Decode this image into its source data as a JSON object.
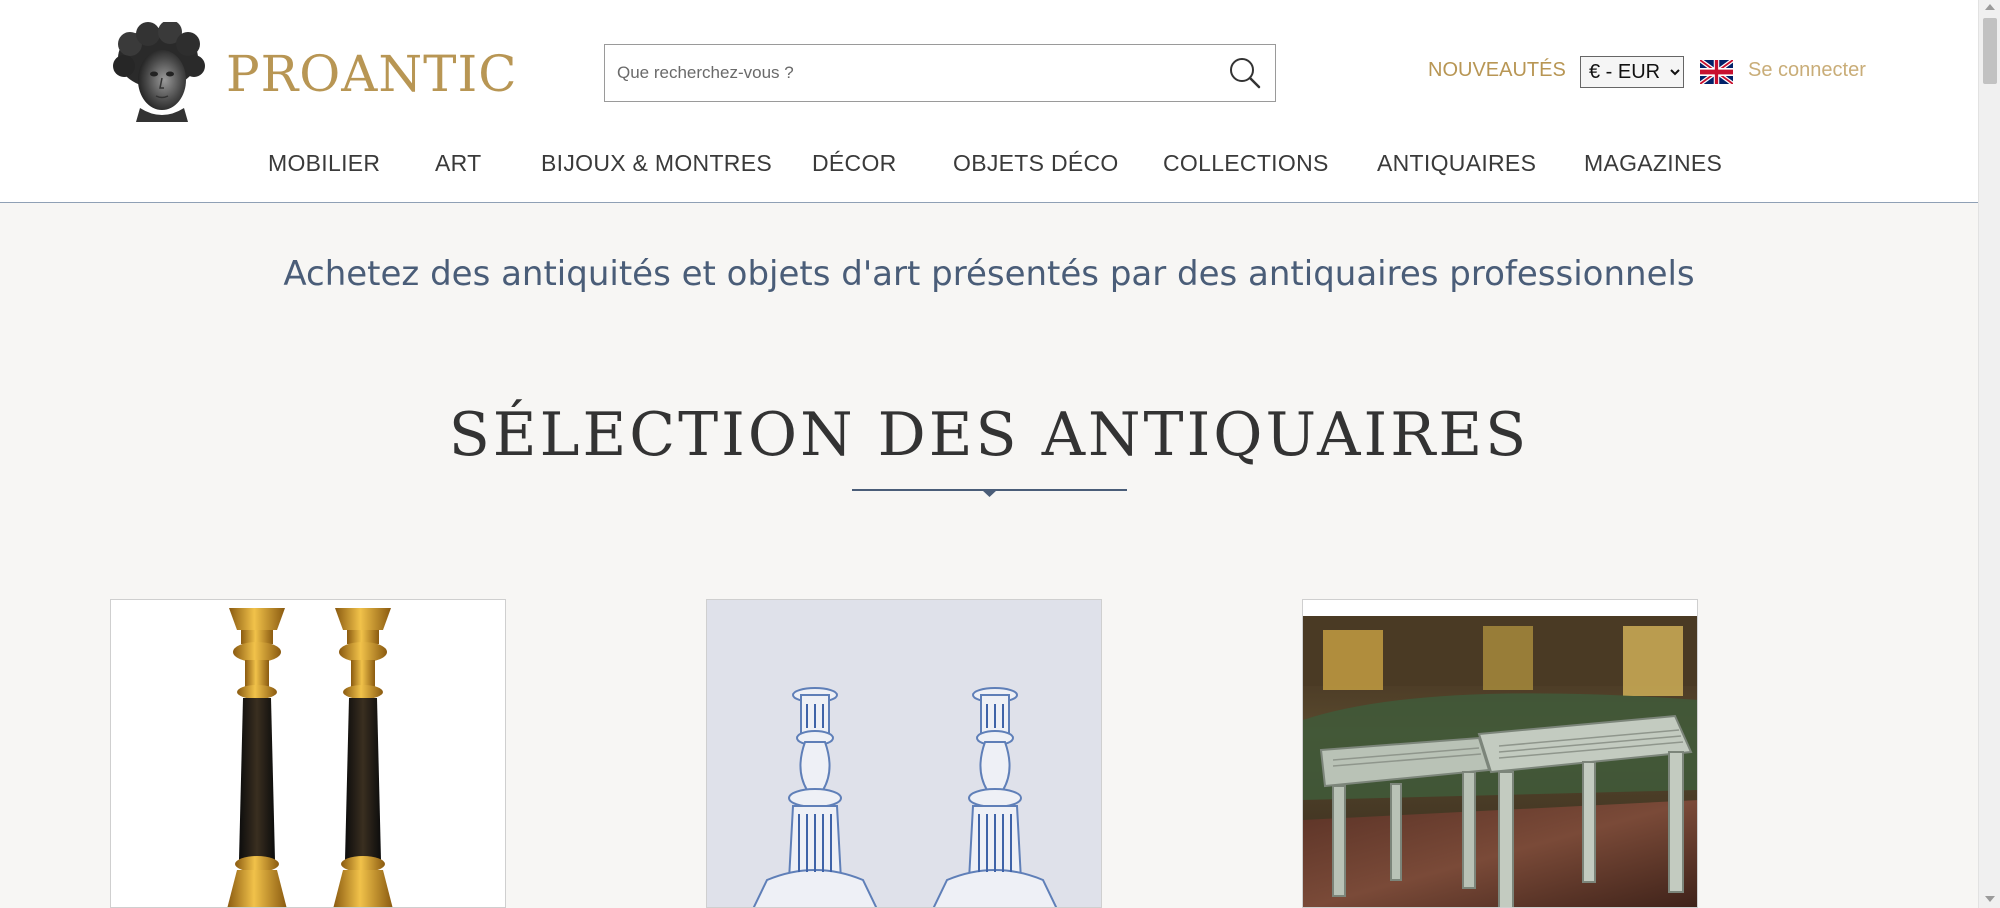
{
  "header": {
    "logo_text": "PROANTIC",
    "search": {
      "placeholder": "Que recherchez-vous ?",
      "value": ""
    },
    "links": {
      "new": "NOUVEAUTÉS",
      "login": "Se connecter"
    },
    "currency": {
      "selected": "€ - EUR"
    },
    "language_flag": "uk-flag-icon"
  },
  "nav": {
    "items": [
      {
        "label": "MOBILIER"
      },
      {
        "label": "ART"
      },
      {
        "label": "BIJOUX & MONTRES"
      },
      {
        "label": "DÉCOR"
      },
      {
        "label": "OBJETS DÉCO"
      },
      {
        "label": "COLLECTIONS"
      },
      {
        "label": "ANTIQUAIRES"
      },
      {
        "label": "MAGAZINES"
      }
    ]
  },
  "main": {
    "tagline": "Achetez des antiquités et objets d'art présentés par des antiquaires professionnels",
    "section_title": "SÉLECTION DES ANTIQUAIRES",
    "products": [
      {
        "icon": "candlesticks-bronze-image"
      },
      {
        "icon": "candlesticks-faience-image"
      },
      {
        "icon": "stools-image"
      }
    ]
  },
  "colors": {
    "brand_gold": "#b89654",
    "login_gold": "#c9ad78",
    "tagline_blue": "#4a5d78",
    "page_bg": "#f7f6f4"
  }
}
